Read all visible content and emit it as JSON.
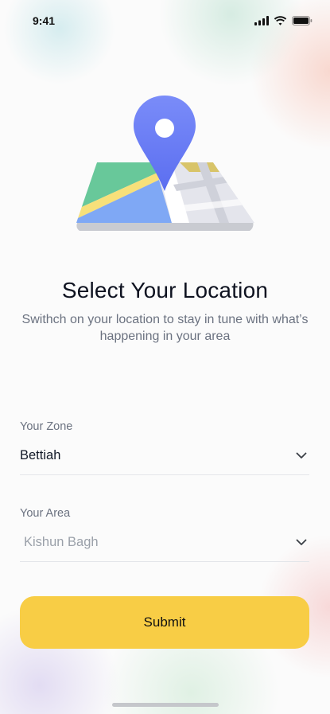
{
  "status_bar": {
    "time": "9:41",
    "icons": [
      "signal-icon",
      "wifi-icon",
      "battery-icon"
    ]
  },
  "illustration": {
    "icon": "map-location-pin-icon",
    "colors": {
      "pin": "#6a7ef8",
      "map_green": "#68c89a",
      "map_yellow": "#f7e07a",
      "map_blue": "#7fa8f5",
      "map_gray": "#e4e5ec",
      "map_base": "#c9cbd1"
    }
  },
  "header": {
    "title": "Select Your Location",
    "subtitle": "Swithch on your location to stay in tune with what’s happening in your area"
  },
  "form": {
    "zone": {
      "label": "Your Zone",
      "value": "Bettiah",
      "icon": "chevron-down-icon"
    },
    "area": {
      "label": "Your Area",
      "placeholder": "Kishun Bagh",
      "icon": "chevron-down-icon"
    },
    "submit_label": "Submit"
  },
  "colors": {
    "accent": "#f8cd45",
    "text_primary": "#0e1220",
    "text_secondary": "#6b7280",
    "placeholder": "#9aa0a9"
  }
}
